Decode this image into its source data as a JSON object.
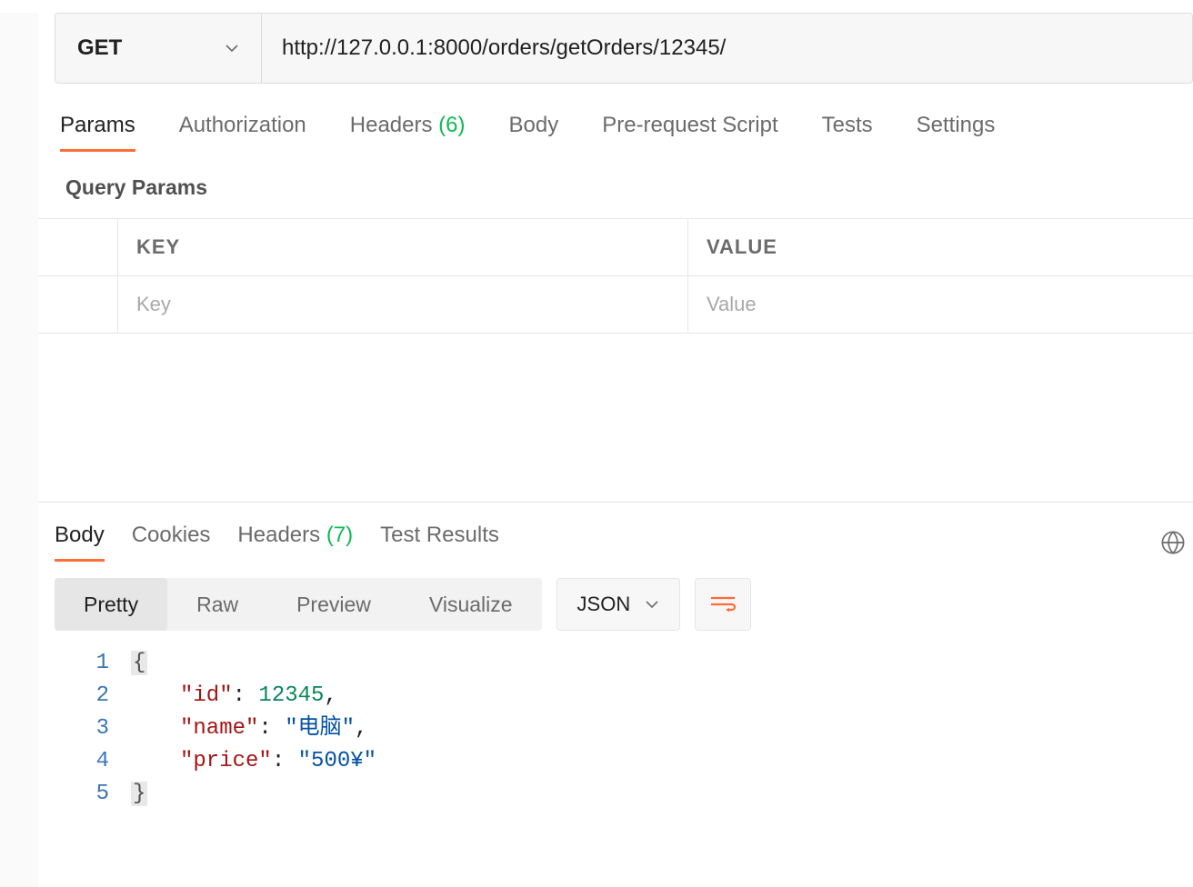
{
  "request": {
    "method": "GET",
    "url": "http://127.0.0.1:8000/orders/getOrders/12345/"
  },
  "req_tabs": {
    "params": "Params",
    "authorization": "Authorization",
    "headers_label": "Headers",
    "headers_count": "(6)",
    "body": "Body",
    "pre_request": "Pre-request Script",
    "tests": "Tests",
    "settings": "Settings"
  },
  "query_params": {
    "title": "Query Params",
    "key_header": "KEY",
    "value_header": "VALUE",
    "key_placeholder": "Key",
    "value_placeholder": "Value"
  },
  "resp_tabs": {
    "body": "Body",
    "cookies": "Cookies",
    "headers_label": "Headers",
    "headers_count": "(7)",
    "test_results": "Test Results"
  },
  "view_modes": {
    "pretty": "Pretty",
    "raw": "Raw",
    "preview": "Preview",
    "visualize": "Visualize"
  },
  "format_select": "JSON",
  "response_json": {
    "lines": [
      {
        "n": "1",
        "parts": [
          {
            "t": "br",
            "v": "{"
          }
        ]
      },
      {
        "n": "2",
        "parts": [
          {
            "t": "indent"
          },
          {
            "t": "key",
            "v": "\"id\""
          },
          {
            "t": "punct",
            "v": ": "
          },
          {
            "t": "num",
            "v": "12345"
          },
          {
            "t": "punct",
            "v": ","
          }
        ]
      },
      {
        "n": "3",
        "parts": [
          {
            "t": "indent"
          },
          {
            "t": "key",
            "v": "\"name\""
          },
          {
            "t": "punct",
            "v": ": "
          },
          {
            "t": "str",
            "v": "\"电脑\""
          },
          {
            "t": "punct",
            "v": ","
          }
        ]
      },
      {
        "n": "4",
        "parts": [
          {
            "t": "indent"
          },
          {
            "t": "key",
            "v": "\"price\""
          },
          {
            "t": "punct",
            "v": ": "
          },
          {
            "t": "str",
            "v": "\"500¥\""
          }
        ]
      },
      {
        "n": "5",
        "parts": [
          {
            "t": "br",
            "v": "}"
          }
        ]
      }
    ]
  }
}
